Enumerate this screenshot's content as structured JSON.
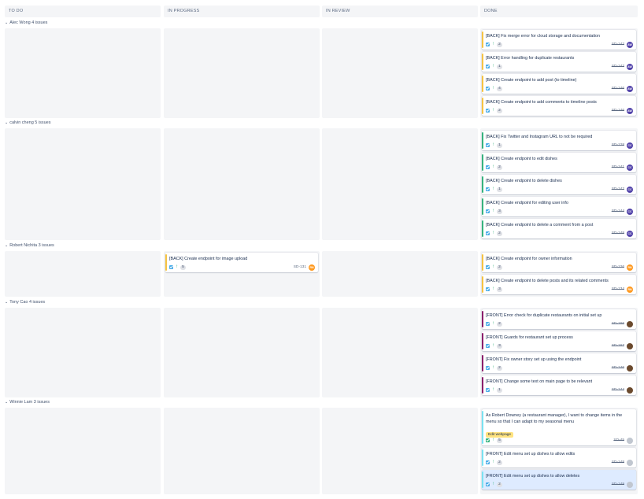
{
  "columns": [
    "TO DO",
    "IN PROGRESS",
    "IN REVIEW",
    "DONE"
  ],
  "colors": {
    "epic_back": "#f6c342",
    "epic_back_green": "#36b37e",
    "epic_front": "#8b1f6b",
    "epic_story": "#79e2f2",
    "avatar_purple": "#5243aa",
    "avatar_orange": "#ff991f",
    "avatar_brown": "#6b4a2e",
    "avatar_grey": "#c1c7d0"
  },
  "swimlanes": [
    {
      "header": "Alec Wong 4 issues",
      "cards": [
        {
          "title": "[BACK] Fix merge error for cloud storage and documentation",
          "points": "2",
          "key": "SD-142",
          "avatar": "AW"
        },
        {
          "title": "[BACK] Error handling for duplicate restaurants",
          "points": "1",
          "key": "SD-142",
          "avatar": "AW"
        },
        {
          "title": "[BACK] Create endpoint to add post (to timeline)",
          "points": "4",
          "key": "SD-146",
          "avatar": "AW"
        },
        {
          "title": "[BACK] Create endpoint to add comments to timeline posts",
          "points": "2",
          "key": "SD-146",
          "avatar": "AW"
        }
      ]
    },
    {
      "header": "calvin cheng 5 issues",
      "cards": [
        {
          "title": "[BACK] Fix Twitter and Instagram URL to not be required",
          "points": "1",
          "key": "SD-128",
          "avatar": "CC"
        },
        {
          "title": "[BACK] Create endpoint to edit dishes",
          "points": "2",
          "key": "SD-141",
          "avatar": "CC"
        },
        {
          "title": "[BACK] Create endpoint to delete dishes",
          "points": "1",
          "key": "SD-142",
          "avatar": "CC"
        },
        {
          "title": "[BACK] Create endpoint for editing user info",
          "points": "3",
          "key": "SD-144",
          "avatar": "CC"
        },
        {
          "title": "[BACK] Create endpoint to delete a comment from a post",
          "points": "2",
          "key": "SD-148",
          "avatar": "CC"
        }
      ]
    },
    {
      "header": "Robert Nichita 3 issues",
      "in_progress_card": {
        "title": "[BACK] Create endpoint for image upload",
        "points": "5",
        "key": "SD-131",
        "avatar": "RN"
      },
      "cards": [
        {
          "title": "[BACK] Create endpoint for owner information",
          "points": "2",
          "key": "SD-126",
          "avatar": "RN"
        },
        {
          "title": "[BACK] Create endpoint to delete posts and its related comments",
          "points": "3",
          "key": "SD-134",
          "avatar": "RN"
        }
      ]
    },
    {
      "header": "Tony Cao 4 issues",
      "cards": [
        {
          "title": "[FRONT] Error check for duplicate restaurants on initial set up",
          "points": "2",
          "key": "SD-166",
          "avatar": ""
        },
        {
          "title": "[FRONT] Guards for restaurant set up process",
          "points": "3",
          "key": "SD-167",
          "avatar": ""
        },
        {
          "title": "[FRONT] Fix owner story set up using the endpoint",
          "points": "2",
          "key": "SD-146",
          "avatar": ""
        },
        {
          "title": "[FRONT] Change some text on main page to be relevant",
          "points": "1",
          "key": "SD-144",
          "avatar": ""
        }
      ]
    },
    {
      "header": "Winnie Lam 3 issues",
      "story_card": {
        "title": "As Robert Downey (a restaurant manager), I want to change items in the menu so that I can adapt to my seasonal menu",
        "label": "Edit webpage",
        "points": "5",
        "key": "SD-45",
        "avatar": ""
      },
      "cards": [
        {
          "title": "[FRONT] Edit menu set up dishes to allow edits",
          "points": "2",
          "key": "SD-148",
          "avatar": ""
        },
        {
          "title": "[FRONT] Edit menu set up dishes to allow deletes",
          "points": "2",
          "key": "SD-149",
          "avatar": ""
        }
      ]
    }
  ]
}
